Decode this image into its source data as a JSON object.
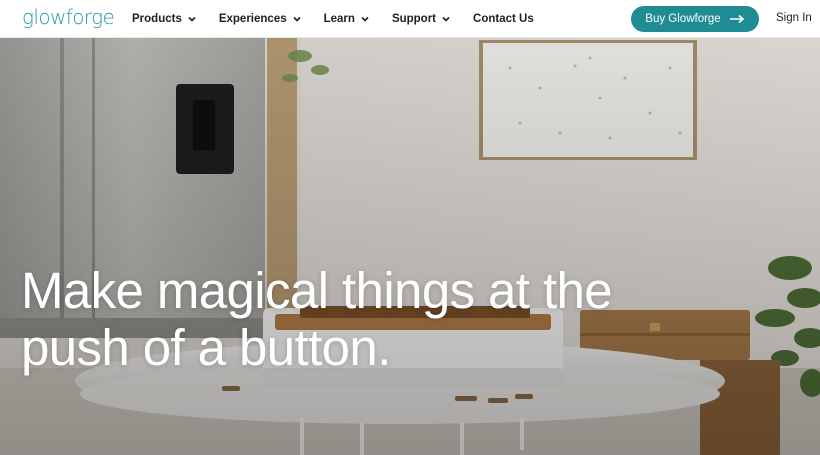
{
  "nav": {
    "logo": "glowforge",
    "items": [
      {
        "label": "Products",
        "has_dropdown": true
      },
      {
        "label": "Experiences",
        "has_dropdown": true
      },
      {
        "label": "Learn",
        "has_dropdown": true
      },
      {
        "label": "Support",
        "has_dropdown": true
      },
      {
        "label": "Contact Us",
        "has_dropdown": false
      }
    ],
    "buy_button": "Buy Glowforge",
    "buy_icon": "arrow-right-icon",
    "sign_in": "Sign In"
  },
  "hero": {
    "headline_line1": "Make magical things at the",
    "headline_line2": "push of a button."
  },
  "colors": {
    "brand": "#2a9a9c",
    "button": "#1f8c93",
    "nav_text": "#1f1f1f"
  }
}
